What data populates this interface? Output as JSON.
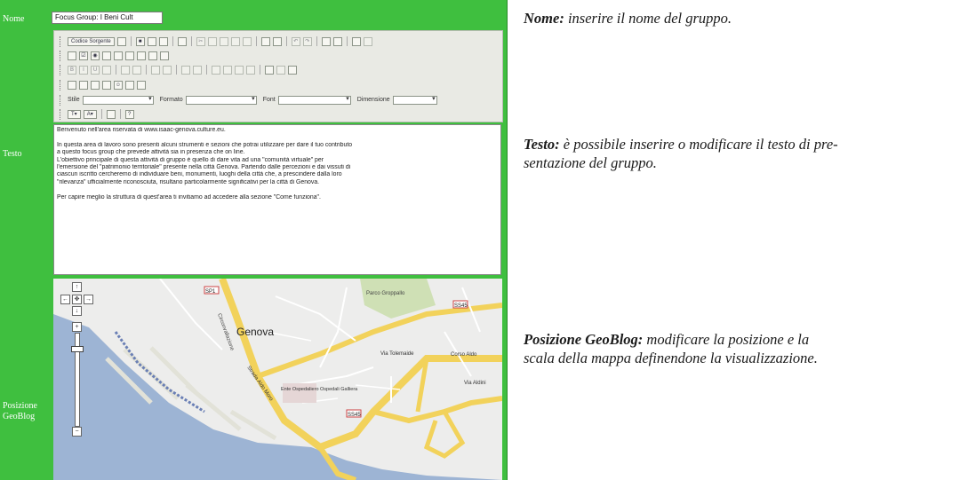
{
  "form": {
    "nome_label": "Nome",
    "nome_value": "Focus Group: I Beni Cult",
    "testo_label": "Testo",
    "posizione_label_1": "Posizione",
    "posizione_label_2": "GeoBlog"
  },
  "toolbar": {
    "codice_sorgente": "Codice Sorgente",
    "stile_label": "Stile",
    "formato_label": "Formato",
    "font_label": "Font",
    "dimensione_label": "Dimensione"
  },
  "editor": {
    "p1": "Benvenuto nell'area riservata di www.isaac-genova.culture.eu.",
    "p2a": "In questa area di lavoro sono presenti alcuni strumenti e sezioni che potrai utilizzare per dare il tuo contributo",
    "p2b": "a questo focus group che prevede attività sia in presenza che on line.",
    "p3a": "L'obiettivo principale di questa attività di gruppo è quello di dare vita ad una \"comunità virtuale\" per",
    "p3b": "l'emersione del \"patrimonio territoriale\" presente nella città Genova. Partendo dalle percezioni e dai vissuti di",
    "p3c": "ciascun iscritto cercheremo di individuare beni, monumenti, luoghi della città che, a prescindere dalla loro",
    "p3d": "\"rilevanza\" ufficialmente riconosciuta, risultano particolarmente significativi per la città di Genova.",
    "p4": "Per capire meglio la struttura di quest'area ti invitiamo ad accedere alla sezione \"Come funziona\"."
  },
  "map": {
    "city_label": "Genova",
    "labels": [
      "SP1",
      "Circonvallazione",
      "Parco Groppallo",
      "SS45",
      "Via Tolemaide",
      "Corso Aldo",
      "Ente Ospedaliero Ospedali Galliera",
      "SS45",
      "Via Aldini",
      "Strada Aldo Moro"
    ]
  },
  "explanations": {
    "nome_term": "Nome:",
    "nome_text": " inserire il nome del gruppo.",
    "testo_term": "Testo:",
    "testo_text_1": " è possibile inserire o modificare il testo di pre-",
    "testo_text_2": "sentazione del gruppo.",
    "pos_term": "Posizione GeoBlog:",
    "pos_text_1": " modificare la posizione e la",
    "pos_text_2": "scala della mappa definendone la visualizzazione."
  }
}
